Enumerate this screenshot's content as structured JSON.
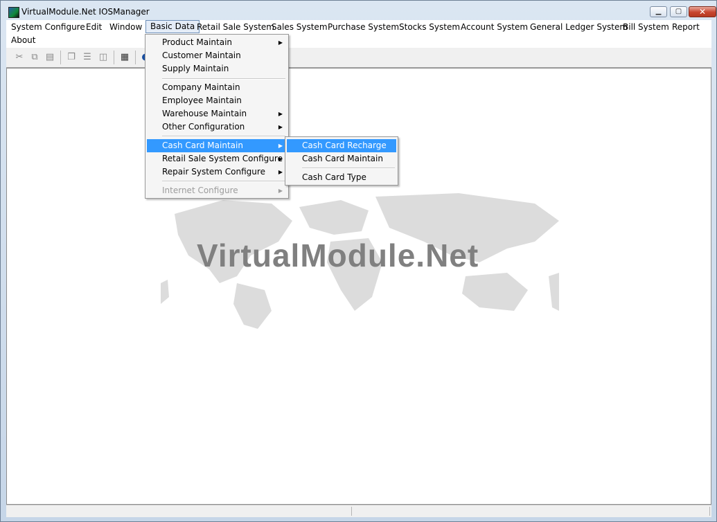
{
  "window": {
    "title": "VirtualModule.Net IOSManager",
    "controls": {
      "minimize": "▁",
      "maximize": "▢",
      "close": "✕"
    }
  },
  "menubar": {
    "items": [
      {
        "label": "System Configure"
      },
      {
        "label": "Edit"
      },
      {
        "label": "Window"
      },
      {
        "label": "Basic Data",
        "active": true
      },
      {
        "label": "Retail Sale System"
      },
      {
        "label": "Sales System"
      },
      {
        "label": "Purchase System"
      },
      {
        "label": "Stocks System"
      },
      {
        "label": "Account System"
      },
      {
        "label": "General Ledger System"
      },
      {
        "label": "Bill System"
      },
      {
        "label": "Report"
      },
      {
        "label": "About"
      }
    ]
  },
  "toolbar": {
    "icons": [
      "cut-icon",
      "copy-icon",
      "paste-icon",
      "cascade-icon",
      "tile-horizontal-icon",
      "tile-vertical-icon",
      "calculator-icon",
      "globe-icon"
    ]
  },
  "basic_data_menu": {
    "items": [
      {
        "label": "Product Maintain",
        "submenu": true
      },
      {
        "label": "Customer Maintain",
        "submenu": false
      },
      {
        "label": "Supply Maintain",
        "submenu": false
      },
      {
        "label": "Company Maintain",
        "submenu": false
      },
      {
        "label": "Employee Maintain",
        "submenu": false
      },
      {
        "label": "Warehouse Maintain",
        "submenu": true
      },
      {
        "label": "Other Configuration",
        "submenu": true
      },
      {
        "label": "Cash Card Maintain",
        "submenu": true,
        "highlighted": true
      },
      {
        "label": "Retail Sale System Configure",
        "submenu": true
      },
      {
        "label": "Repair System Configure",
        "submenu": true
      },
      {
        "label": "Internet Configure",
        "submenu": true,
        "disabled": true
      }
    ]
  },
  "cash_card_submenu": {
    "items": [
      {
        "label": "Cash Card Recharge",
        "highlighted": true
      },
      {
        "label": "Cash Card Maintain"
      },
      {
        "label": "Cash Card Type"
      }
    ]
  },
  "background": {
    "brand_text": "VirtualModule.Net"
  },
  "colors": {
    "highlight": "#3399ff",
    "menubar": "#ffffff",
    "disabled_text": "#9c9c9c"
  }
}
